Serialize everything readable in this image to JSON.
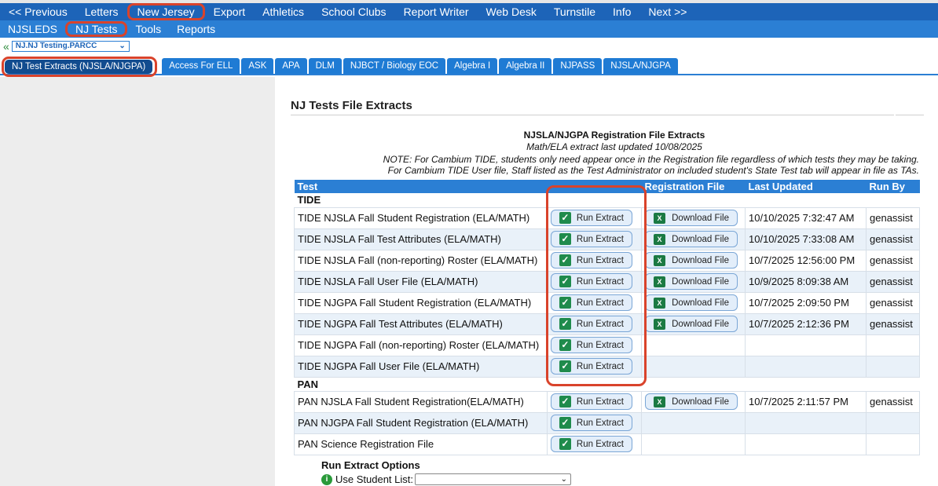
{
  "nav_primary": [
    "<< Previous",
    "Letters",
    "New Jersey",
    "Export",
    "Athletics",
    "School Clubs",
    "Report Writer",
    "Web Desk",
    "Turnstile",
    "Info",
    "Next >>"
  ],
  "nav_secondary": [
    "NJSLEDS",
    "NJ Tests",
    "Tools",
    "Reports"
  ],
  "selector": {
    "value": "NJ.NJ Testing.PARCC"
  },
  "tabs": [
    "NJ Test Extracts (NJSLA/NJGPA)",
    "Access For ELL",
    "ASK",
    "APA",
    "DLM",
    "NJBCT / Biology EOC",
    "Algebra I",
    "Algebra II",
    "NJPASS",
    "NJSLA/NJGPA"
  ],
  "page": {
    "title": "NJ Tests File Extracts",
    "section_title": "NJSLA/NJGPA Registration File Extracts",
    "section_subtitle": "Math/ELA extract last updated 10/08/2025",
    "note1": "NOTE: For Cambium TIDE, students only need appear once in the Registration file regardless of which tests they may be taking.",
    "note2": "For Cambium TIDE User file, Staff listed as the Test Administrator on included student's State Test tab will appear in file as TAs."
  },
  "table": {
    "headers": {
      "test": "Test",
      "run": "",
      "file": "Registration File",
      "updated": "Last Updated",
      "by": "Run By"
    },
    "run_label": "Run Extract",
    "download_label": "Download File",
    "sections": {
      "tide": "TIDE",
      "pan": "PAN"
    },
    "tide_rows": [
      {
        "test": "TIDE NJSLA Fall Student Registration (ELA/MATH)",
        "updated": "10/10/2025 7:32:47 AM",
        "by": "genassist"
      },
      {
        "test": "TIDE NJSLA Fall Test Attributes (ELA/MATH)",
        "updated": "10/10/2025 7:33:08 AM",
        "by": "genassist"
      },
      {
        "test": "TIDE NJSLA Fall (non-reporting) Roster (ELA/MATH)",
        "updated": "10/7/2025 12:56:00 PM",
        "by": "genassist"
      },
      {
        "test": "TIDE NJSLA Fall User File (ELA/MATH)",
        "updated": "10/9/2025 8:09:38 AM",
        "by": "genassist"
      },
      {
        "test": "TIDE NJGPA Fall Student Registration (ELA/MATH)",
        "updated": "10/7/2025 2:09:50 PM",
        "by": "genassist"
      },
      {
        "test": "TIDE NJGPA Fall Test Attributes (ELA/MATH)",
        "updated": "10/7/2025 2:12:36 PM",
        "by": "genassist"
      },
      {
        "test": "TIDE NJGPA Fall (non-reporting) Roster (ELA/MATH)",
        "updated": "",
        "by": ""
      },
      {
        "test": "TIDE NJGPA Fall User File (ELA/MATH)",
        "updated": "",
        "by": ""
      }
    ],
    "pan_rows": [
      {
        "test": "PAN NJSLA Fall Student Registration(ELA/MATH)",
        "updated": "10/7/2025 2:11:57 PM",
        "by": "genassist"
      },
      {
        "test": "PAN NJGPA Fall Student Registration (ELA/MATH)",
        "updated": "",
        "by": ""
      },
      {
        "test": "PAN Science Registration File",
        "updated": "",
        "by": ""
      }
    ]
  },
  "options": {
    "title": "Run Extract Options",
    "student_list_label": "Use Student List:",
    "student_list_value": ""
  },
  "icons": {
    "check": "check-icon",
    "excel": "excel-icon",
    "info": "info-icon"
  },
  "colors": {
    "nav_primary": "#1d64b8",
    "nav_secondary": "#2b7fd4",
    "highlight": "#d9432b"
  }
}
